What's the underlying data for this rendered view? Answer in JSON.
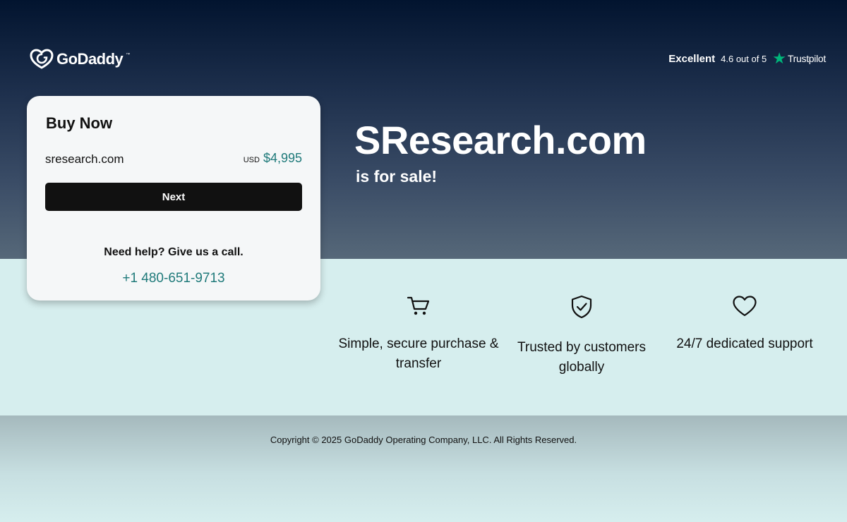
{
  "brand": {
    "name": "GoDaddy",
    "trademark": "™",
    "logo_icon": "godaddy-logo-icon"
  },
  "rating": {
    "label": "Excellent",
    "score": "4.6 out of 5",
    "provider": "Trustpilot",
    "star_icon": "trustpilot-star-icon",
    "star_color": "#00b67a"
  },
  "card": {
    "title": "Buy Now",
    "domain": "sresearch.com",
    "currency": "USD",
    "price": "$4,995",
    "next_label": "Next",
    "help_text": "Need help? Give us a call.",
    "phone": "+1 480-651-9713"
  },
  "hero": {
    "title": "SResearch.com",
    "subtitle": "is for sale!"
  },
  "features": [
    {
      "icon": "shopping-cart-icon",
      "label": "Simple, secure purchase & transfer"
    },
    {
      "icon": "shield-check-icon",
      "label": "Trusted by customers globally"
    },
    {
      "icon": "heart-icon",
      "label": "24/7 dedicated support"
    }
  ],
  "footer": {
    "copyright": "Copyright © 2025 GoDaddy Operating Company, LLC. All Rights Reserved."
  },
  "colors": {
    "accent": "#1f7a7a",
    "button": "#111111",
    "hero_top": "#02142f",
    "band": "#d6eeee"
  }
}
